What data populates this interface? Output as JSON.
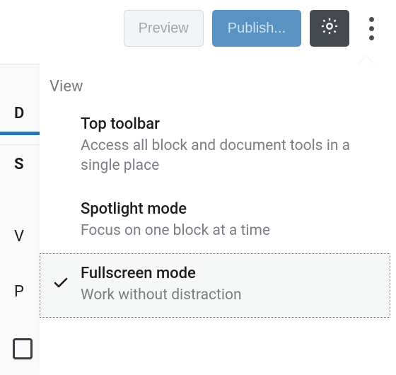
{
  "toolbar": {
    "preview_label": "Preview",
    "publish_label": "Publish..."
  },
  "menu": {
    "header": "View",
    "items": [
      {
        "title": "Top toolbar",
        "desc": "Access all block and document tools in a single place"
      },
      {
        "title": "Spotlight mode",
        "desc": "Focus on one block at a time"
      },
      {
        "title": "Fullscreen mode",
        "desc": "Work without distraction"
      }
    ]
  },
  "sidebar": {
    "t1": "D",
    "t2": "S",
    "t3": "V",
    "t4": "P"
  }
}
